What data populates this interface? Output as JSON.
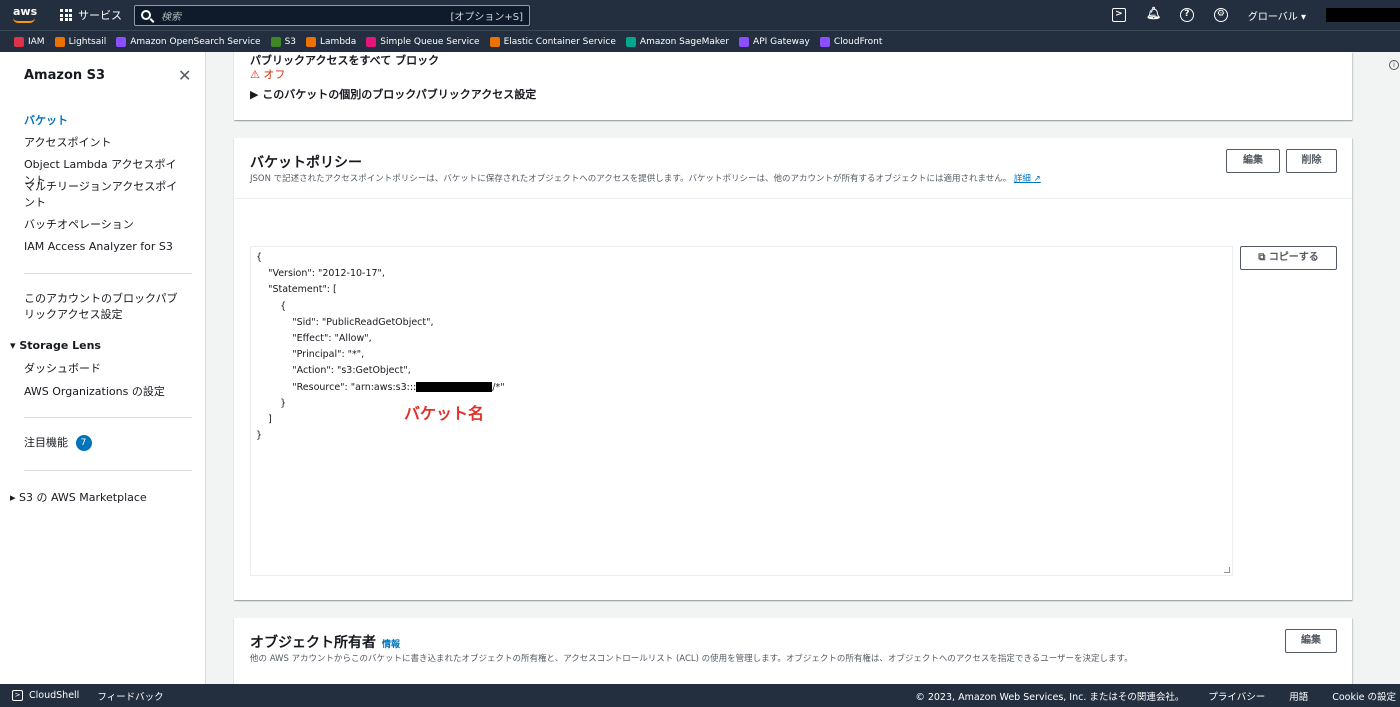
{
  "topnav": {
    "logo": "aws",
    "services": "サービス",
    "search_placeholder": "検索",
    "search_hint": "[オプション+S]",
    "region": "グローバル ▾"
  },
  "favorites": [
    {
      "label": "IAM",
      "color": "#dd344c"
    },
    {
      "label": "Lightsail",
      "color": "#ed7100"
    },
    {
      "label": "Amazon OpenSearch Service",
      "color": "#8c4fff"
    },
    {
      "label": "S3",
      "color": "#3f8624"
    },
    {
      "label": "Lambda",
      "color": "#ed7100"
    },
    {
      "label": "Simple Queue Service",
      "color": "#e7157b"
    },
    {
      "label": "Elastic Container Service",
      "color": "#ed7100"
    },
    {
      "label": "Amazon SageMaker",
      "color": "#01a88d"
    },
    {
      "label": "API Gateway",
      "color": "#8c4fff"
    },
    {
      "label": "CloudFront",
      "color": "#8c4fff"
    }
  ],
  "sidebar": {
    "title": "Amazon S3",
    "items": [
      "バケット",
      "アクセスポイント",
      "Object Lambda アクセスポイント",
      "マルチリージョンアクセスポイント",
      "バッチオペレーション",
      "IAM Access Analyzer for S3",
      "このアカウントのブロックパブリックアクセス設定",
      "Storage Lens",
      "ダッシュボード",
      "AWS Organizations の設定",
      "注目機能",
      "S3 の AWS Marketplace"
    ],
    "badge": "7"
  },
  "bpa": {
    "label": "パブリックアクセスをすべて ブロック",
    "value": "オフ",
    "expander": "このバケットの個別のブロックパブリックアクセス設定"
  },
  "policy": {
    "title": "バケットポリシー",
    "description": "JSON で記述されたアクセスポイントポリシーは、バケットに保存されたオブジェクトへのアクセスを提供します。バケットポリシーは、他のアカウントが所有するオブジェクトには適用されません。",
    "details_link": "詳細",
    "edit_button": "編集",
    "delete_button": "削除",
    "copy_button": "コピーする",
    "code_lines": [
      "{",
      "    \"Version\": \"2012-10-17\",",
      "    \"Statement\": [",
      "        {",
      "            \"Sid\": \"PublicReadGetObject\",",
      "            \"Effect\": \"Allow\",",
      "            \"Principal\": \"*\",",
      "            \"Action\": \"s3:GetObject\",",
      "            \"Resource\": \"arn:aws:s3:::",
      "        }",
      "    ]",
      "}"
    ],
    "resource_suffix": "/*\"",
    "annotation": "バケット名"
  },
  "ownership": {
    "title": "オブジェクト所有者",
    "info": "情報",
    "description": "他の AWS アカウントからこのバケットに書き込まれたオブジェクトの所有権と、アクセスコントロールリスト (ACL) の使用を管理します。オブジェクトの所有権は、オブジェクトへのアクセスを指定できるユーザーを決定します。",
    "edit_button": "編集"
  },
  "footer": {
    "cloudshell": "CloudShell",
    "feedback": "フィードバック",
    "copyright": "© 2023, Amazon Web Services, Inc. またはその関連会社。",
    "privacy": "プライバシー",
    "terms": "用語",
    "cookie": "Cookie の設定"
  }
}
